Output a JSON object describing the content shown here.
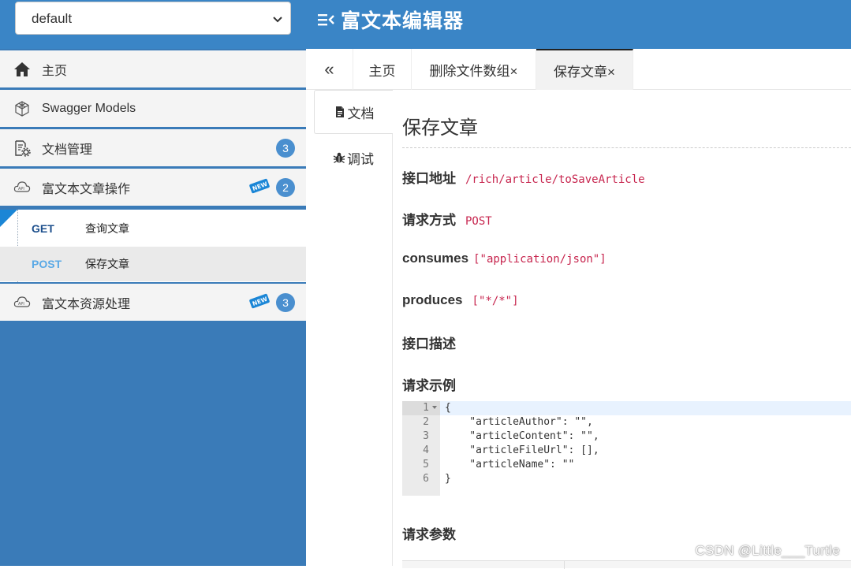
{
  "header": {
    "group_select": {
      "value": "default"
    },
    "title": "富文本编辑器"
  },
  "sidebar": {
    "items": [
      {
        "label": "主页",
        "icon": "home-icon"
      },
      {
        "label": "Swagger Models",
        "icon": "cube-icon"
      },
      {
        "label": "文档管理",
        "icon": "document-settings-icon",
        "badge": "3"
      },
      {
        "label": "富文本文章操作",
        "icon": "api-cloud-icon",
        "badge": "2",
        "tag": "NEW"
      },
      {
        "label": "富文本资源处理",
        "icon": "api-cloud-icon",
        "badge": "3",
        "tag": "NEW"
      }
    ],
    "sub_items": [
      {
        "method": "GET",
        "label": "查询文章",
        "method_color": "#1c4f8c"
      },
      {
        "method": "POST",
        "label": "保存文章",
        "method_color": "#5aa9e6"
      }
    ]
  },
  "tabs": {
    "collapse_glyph": "«",
    "items": [
      {
        "label": "主页"
      },
      {
        "label": "删除文件数组×"
      },
      {
        "label": "保存文章×"
      }
    ]
  },
  "doc_tabs": [
    {
      "label": "文档"
    },
    {
      "label": "调试"
    }
  ],
  "doc": {
    "title": "保存文章",
    "fields": [
      {
        "key": "接口地址",
        "value": "/rich/article/toSaveArticle"
      },
      {
        "key": "请求方式",
        "value": "POST"
      },
      {
        "key": "consumes",
        "value": "[\"application/json\"]"
      },
      {
        "key": "produces",
        "value": "[\"*/*\"]"
      }
    ],
    "desc_label": "接口描述",
    "example_label": "请求示例",
    "code_lines": [
      {
        "n": "1",
        "text": "{"
      },
      {
        "n": "2",
        "text": "    \"articleAuthor\": \"\","
      },
      {
        "n": "3",
        "text": "    \"articleContent\": \"\","
      },
      {
        "n": "4",
        "text": "    \"articleFileUrl\": [],"
      },
      {
        "n": "5",
        "text": "    \"articleName\": \"\""
      },
      {
        "n": "6",
        "text": "}"
      }
    ],
    "params_label": "请求参数"
  },
  "watermark": "CSDN @Little___Turtle",
  "colors": {
    "header_bg": "#3a85c6",
    "sidebar_bg": "#3a7bb8",
    "badge": "#4a8fcf",
    "value_red": "#c7254e"
  }
}
